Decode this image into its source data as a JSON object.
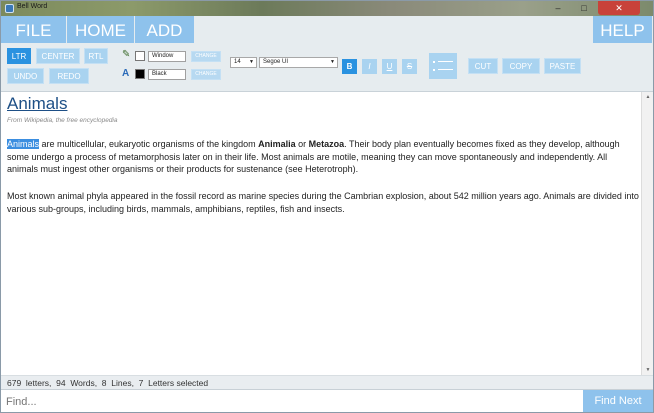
{
  "window": {
    "title": "Bell Word",
    "min": "–",
    "max": "□",
    "close": "✕"
  },
  "menu": {
    "file": "FILE",
    "home": "HOME",
    "add": "ADD",
    "help": "HELP"
  },
  "ribbon": {
    "align": {
      "ltr": "LTR",
      "center": "CENTER",
      "rtl": "RTL"
    },
    "undo": "UNDO",
    "redo": "REDO",
    "highlight_color": {
      "value": "Window",
      "button": "CHANGE"
    },
    "font_color": {
      "value": "Black",
      "button": "CHANGE"
    },
    "font_size": "14",
    "font_family": "Segoe UI",
    "format": {
      "bold": "B",
      "italic": "I",
      "underline": "U",
      "strike": "S"
    },
    "clipboard": {
      "cut": "CUT",
      "copy": "COPY",
      "paste": "PASTE"
    }
  },
  "colors": {
    "accent": "#8ec2ec",
    "active": "#2a92e0",
    "title_link": "#1d4f86"
  },
  "document": {
    "title": "Animals",
    "subtitle": "From Wikipedia, the free encyclopedia",
    "p1": {
      "sel": "Animals",
      "t1": " are multicellular, eukaryotic organisms of the kingdom ",
      "b1": "Animalia",
      "t2": " or ",
      "b2": "Metazoa",
      "t3": ". Their body plan eventually becomes fixed as they develop, although some undergo a process of metamorphosis later on in their life. Most animals are motile, meaning they can move spontaneously and independently. All animals must ingest other organisms or their products for sustenance (see Heterotroph)."
    },
    "p2": "Most known animal phyla appeared in the fossil record as marine species during the Cambrian explosion, about 542 million years ago. Animals are divided into various sub-groups, including birds, mammals, amphibians, reptiles, fish and insects."
  },
  "status": "679  letters,  94  Words,  8  Lines,  7  Letters selected",
  "find": {
    "placeholder": "Find...",
    "next": "Find Next"
  }
}
